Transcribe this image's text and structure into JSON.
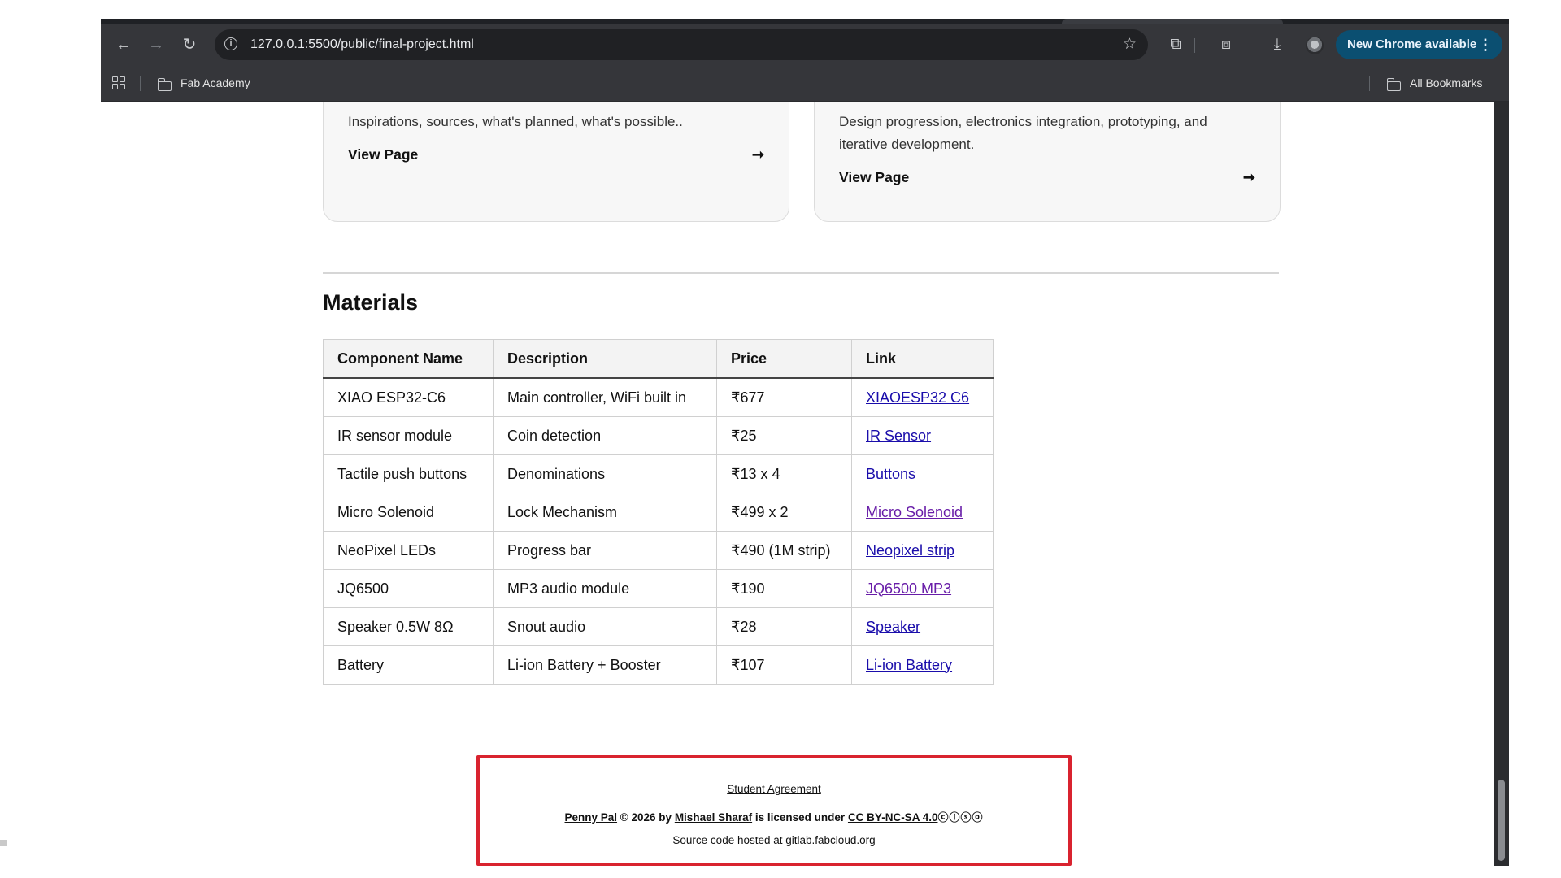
{
  "browser": {
    "url": "127.0.0.1:5500/public/final-project.html",
    "update_button": "New Chrome available",
    "bookmarks": [
      {
        "label": "Fab Academy"
      }
    ],
    "all_bookmarks": "All Bookmarks"
  },
  "cards": [
    {
      "description": "Inspirations, sources, what's planned, what's possible..",
      "link": "View Page"
    },
    {
      "description": "Design progression, electronics integration, prototyping, and iterative development.",
      "link": "View Page"
    }
  ],
  "materials": {
    "title": "Materials",
    "headers": [
      "Component Name",
      "Description",
      "Price",
      "Link"
    ],
    "rows": [
      {
        "name": "XIAO ESP32-C6",
        "desc": "Main controller, WiFi built in",
        "price": "₹677",
        "link": "XIAOESP32 C6",
        "visited": false
      },
      {
        "name": "IR sensor module",
        "desc": "Coin detection",
        "price": "₹25",
        "link": "IR Sensor",
        "visited": false
      },
      {
        "name": "Tactile push buttons",
        "desc": "Denominations",
        "price": "₹13 x 4",
        "link": "Buttons",
        "visited": false
      },
      {
        "name": "Micro Solenoid",
        "desc": "Lock Mechanism",
        "price": "₹499 x 2",
        "link": "Micro Solenoid",
        "visited": true
      },
      {
        "name": "NeoPixel LEDs",
        "desc": "Progress bar",
        "price": "₹490 (1M strip)",
        "link": "Neopixel strip",
        "visited": false
      },
      {
        "name": "JQ6500",
        "desc": "MP3 audio module",
        "price": "₹190",
        "link": "JQ6500 MP3",
        "visited": true
      },
      {
        "name": "Speaker 0.5W 8Ω",
        "desc": "Snout audio",
        "price": "₹28",
        "link": "Speaker",
        "visited": false
      },
      {
        "name": "Battery",
        "desc": "Li-ion Battery + Booster",
        "price": "₹107",
        "link": "Li-ion Battery",
        "visited": false
      }
    ]
  },
  "footer": {
    "agreement": "Student Agreement",
    "project": "Penny Pal",
    "copyright": "© 2026 by",
    "author": "Mishael Sharaf",
    "licensed": "is licensed under",
    "license": "CC BY-NC-SA 4.0",
    "cc_icons": "ⓒⓘⓢⓞ",
    "source_text": "Source code hosted at",
    "source_link": "gitlab.fabcloud.org"
  },
  "colors": {
    "footer_border": "#d9232f",
    "link": "#1a0dab",
    "link_visited": "#681da8",
    "chrome_update": "#0b4f71"
  }
}
